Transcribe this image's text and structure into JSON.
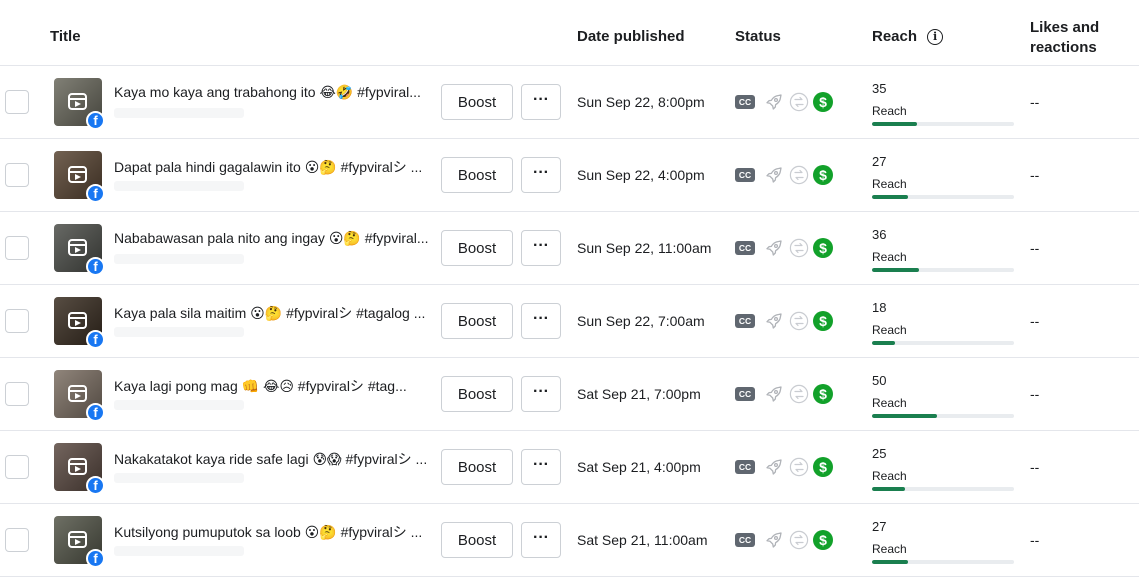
{
  "header": {
    "title": "Title",
    "date_published": "Date published",
    "status": "Status",
    "reach": "Reach",
    "reach_info_icon": "info-icon",
    "likes_and_reactions": "Likes and reactions"
  },
  "colors": {
    "accent_green": "#1a7f4f",
    "facebook_blue": "#1877f2",
    "monetize_green": "#12a12a"
  },
  "rows": [
    {
      "title": "Kaya mo kaya ang trabahong ito 😂🤣 #fypviral...",
      "boost": "Boost",
      "more": "···",
      "date": "Sun Sep 22, 8:00pm",
      "cc": "CC",
      "reach": "35",
      "reach_label": "Reach",
      "reach_fill": 0.32,
      "likes": "--",
      "thumb_color": "#6b6a5e"
    },
    {
      "title": "Dapat pala hindi gagalawin ito 😮🤔 #fypviralシ ...",
      "boost": "Boost",
      "more": "···",
      "date": "Sun Sep 22, 4:00pm",
      "cc": "CC",
      "reach": "27",
      "reach_label": "Reach",
      "reach_fill": 0.25,
      "likes": "--",
      "thumb_color": "#5a4634"
    },
    {
      "title": "Nababawasan pala nito ang ingay 😮🤔 #fypviral...",
      "boost": "Boost",
      "more": "···",
      "date": "Sun Sep 22, 11:00am",
      "cc": "CC",
      "reach": "36",
      "reach_label": "Reach",
      "reach_fill": 0.33,
      "likes": "--",
      "thumb_color": "#4d4f4a"
    },
    {
      "title": "Kaya pala sila maitim 😮🤔 #fypviralシ #tagalog ...",
      "boost": "Boost",
      "more": "···",
      "date": "Sun Sep 22, 7:00am",
      "cc": "CC",
      "reach": "18",
      "reach_label": "Reach",
      "reach_fill": 0.16,
      "likes": "--",
      "thumb_color": "#3a2e22"
    },
    {
      "title": "Kaya lagi pong mag 👊 😂😥 #fypviralシ #tag...",
      "boost": "Boost",
      "more": "···",
      "date": "Sat Sep 21, 7:00pm",
      "cc": "CC",
      "reach": "50",
      "reach_label": "Reach",
      "reach_fill": 0.46,
      "likes": "--",
      "thumb_color": "#7d7064"
    },
    {
      "title": "Nakakatakot kaya ride safe lagi 😰😱 #fypviralシ ...",
      "boost": "Boost",
      "more": "···",
      "date": "Sat Sep 21, 4:00pm",
      "cc": "CC",
      "reach": "25",
      "reach_label": "Reach",
      "reach_fill": 0.23,
      "likes": "--",
      "thumb_color": "#5b4a42"
    },
    {
      "title": "Kutsilyong pumuputok sa loob 😮🤔 #fypviralシ ...",
      "boost": "Boost",
      "more": "···",
      "date": "Sat Sep 21, 11:00am",
      "cc": "CC",
      "reach": "27",
      "reach_label": "Reach",
      "reach_fill": 0.25,
      "likes": "--",
      "thumb_color": "#55574a"
    }
  ]
}
